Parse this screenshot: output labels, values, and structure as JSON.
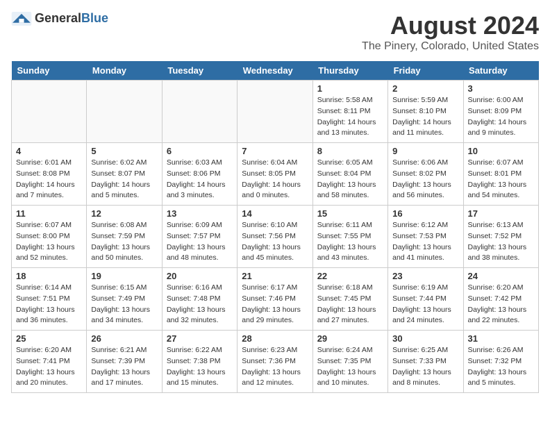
{
  "header": {
    "logo_general": "General",
    "logo_blue": "Blue",
    "month_title": "August 2024",
    "location": "The Pinery, Colorado, United States"
  },
  "weekdays": [
    "Sunday",
    "Monday",
    "Tuesday",
    "Wednesday",
    "Thursday",
    "Friday",
    "Saturday"
  ],
  "weeks": [
    [
      {
        "day": "",
        "info": ""
      },
      {
        "day": "",
        "info": ""
      },
      {
        "day": "",
        "info": ""
      },
      {
        "day": "",
        "info": ""
      },
      {
        "day": "1",
        "info": "Sunrise: 5:58 AM\nSunset: 8:11 PM\nDaylight: 14 hours\nand 13 minutes."
      },
      {
        "day": "2",
        "info": "Sunrise: 5:59 AM\nSunset: 8:10 PM\nDaylight: 14 hours\nand 11 minutes."
      },
      {
        "day": "3",
        "info": "Sunrise: 6:00 AM\nSunset: 8:09 PM\nDaylight: 14 hours\nand 9 minutes."
      }
    ],
    [
      {
        "day": "4",
        "info": "Sunrise: 6:01 AM\nSunset: 8:08 PM\nDaylight: 14 hours\nand 7 minutes."
      },
      {
        "day": "5",
        "info": "Sunrise: 6:02 AM\nSunset: 8:07 PM\nDaylight: 14 hours\nand 5 minutes."
      },
      {
        "day": "6",
        "info": "Sunrise: 6:03 AM\nSunset: 8:06 PM\nDaylight: 14 hours\nand 3 minutes."
      },
      {
        "day": "7",
        "info": "Sunrise: 6:04 AM\nSunset: 8:05 PM\nDaylight: 14 hours\nand 0 minutes."
      },
      {
        "day": "8",
        "info": "Sunrise: 6:05 AM\nSunset: 8:04 PM\nDaylight: 13 hours\nand 58 minutes."
      },
      {
        "day": "9",
        "info": "Sunrise: 6:06 AM\nSunset: 8:02 PM\nDaylight: 13 hours\nand 56 minutes."
      },
      {
        "day": "10",
        "info": "Sunrise: 6:07 AM\nSunset: 8:01 PM\nDaylight: 13 hours\nand 54 minutes."
      }
    ],
    [
      {
        "day": "11",
        "info": "Sunrise: 6:07 AM\nSunset: 8:00 PM\nDaylight: 13 hours\nand 52 minutes."
      },
      {
        "day": "12",
        "info": "Sunrise: 6:08 AM\nSunset: 7:59 PM\nDaylight: 13 hours\nand 50 minutes."
      },
      {
        "day": "13",
        "info": "Sunrise: 6:09 AM\nSunset: 7:57 PM\nDaylight: 13 hours\nand 48 minutes."
      },
      {
        "day": "14",
        "info": "Sunrise: 6:10 AM\nSunset: 7:56 PM\nDaylight: 13 hours\nand 45 minutes."
      },
      {
        "day": "15",
        "info": "Sunrise: 6:11 AM\nSunset: 7:55 PM\nDaylight: 13 hours\nand 43 minutes."
      },
      {
        "day": "16",
        "info": "Sunrise: 6:12 AM\nSunset: 7:53 PM\nDaylight: 13 hours\nand 41 minutes."
      },
      {
        "day": "17",
        "info": "Sunrise: 6:13 AM\nSunset: 7:52 PM\nDaylight: 13 hours\nand 38 minutes."
      }
    ],
    [
      {
        "day": "18",
        "info": "Sunrise: 6:14 AM\nSunset: 7:51 PM\nDaylight: 13 hours\nand 36 minutes."
      },
      {
        "day": "19",
        "info": "Sunrise: 6:15 AM\nSunset: 7:49 PM\nDaylight: 13 hours\nand 34 minutes."
      },
      {
        "day": "20",
        "info": "Sunrise: 6:16 AM\nSunset: 7:48 PM\nDaylight: 13 hours\nand 32 minutes."
      },
      {
        "day": "21",
        "info": "Sunrise: 6:17 AM\nSunset: 7:46 PM\nDaylight: 13 hours\nand 29 minutes."
      },
      {
        "day": "22",
        "info": "Sunrise: 6:18 AM\nSunset: 7:45 PM\nDaylight: 13 hours\nand 27 minutes."
      },
      {
        "day": "23",
        "info": "Sunrise: 6:19 AM\nSunset: 7:44 PM\nDaylight: 13 hours\nand 24 minutes."
      },
      {
        "day": "24",
        "info": "Sunrise: 6:20 AM\nSunset: 7:42 PM\nDaylight: 13 hours\nand 22 minutes."
      }
    ],
    [
      {
        "day": "25",
        "info": "Sunrise: 6:20 AM\nSunset: 7:41 PM\nDaylight: 13 hours\nand 20 minutes."
      },
      {
        "day": "26",
        "info": "Sunrise: 6:21 AM\nSunset: 7:39 PM\nDaylight: 13 hours\nand 17 minutes."
      },
      {
        "day": "27",
        "info": "Sunrise: 6:22 AM\nSunset: 7:38 PM\nDaylight: 13 hours\nand 15 minutes."
      },
      {
        "day": "28",
        "info": "Sunrise: 6:23 AM\nSunset: 7:36 PM\nDaylight: 13 hours\nand 12 minutes."
      },
      {
        "day": "29",
        "info": "Sunrise: 6:24 AM\nSunset: 7:35 PM\nDaylight: 13 hours\nand 10 minutes."
      },
      {
        "day": "30",
        "info": "Sunrise: 6:25 AM\nSunset: 7:33 PM\nDaylight: 13 hours\nand 8 minutes."
      },
      {
        "day": "31",
        "info": "Sunrise: 6:26 AM\nSunset: 7:32 PM\nDaylight: 13 hours\nand 5 minutes."
      }
    ]
  ]
}
